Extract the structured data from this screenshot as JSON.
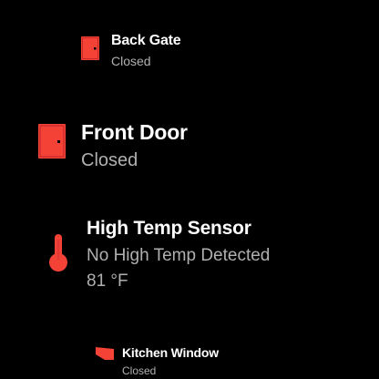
{
  "accent_color": "#f44336",
  "items": [
    {
      "title": "Back Gate",
      "status": "Closed",
      "icon": "door-icon"
    },
    {
      "title": "Front Door",
      "status": "Closed",
      "icon": "door-icon"
    },
    {
      "title": "High Temp Sensor",
      "status": "No High Temp Detected",
      "reading": "81 °F",
      "icon": "thermometer-icon"
    },
    {
      "title": "Kitchen Window",
      "status": "Closed",
      "icon": "window-icon"
    }
  ]
}
